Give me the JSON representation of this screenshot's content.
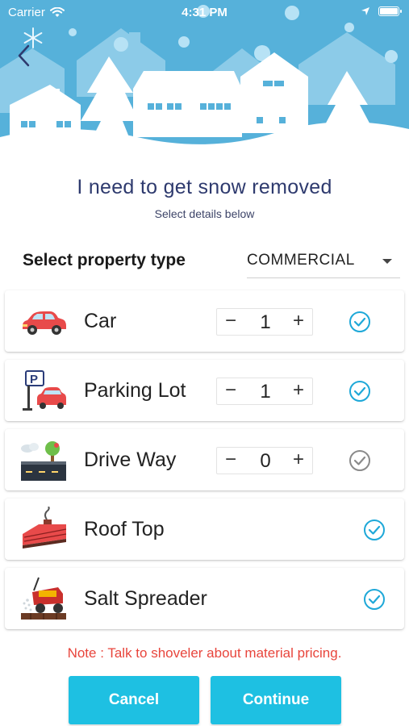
{
  "status_bar": {
    "carrier": "Carrier",
    "time": "4:31 PM"
  },
  "header": {
    "title": "I need to get snow removed",
    "subtitle": "Select details below"
  },
  "property": {
    "label": "Select property type",
    "value": "COMMERCIAL"
  },
  "services": [
    {
      "label": "Car",
      "quantity": "1",
      "selected": true,
      "icon": "car-icon"
    },
    {
      "label": "Parking Lot",
      "quantity": "1",
      "selected": true,
      "icon": "parking-lot-icon"
    },
    {
      "label": "Drive Way",
      "quantity": "0",
      "selected": false,
      "icon": "driveway-icon"
    },
    {
      "label": "Roof Top",
      "selected": true,
      "icon": "roof-top-icon"
    },
    {
      "label": "Salt Spreader",
      "selected": true,
      "icon": "salt-spreader-icon"
    }
  ],
  "stepper": {
    "minus": "−",
    "plus": "+"
  },
  "note": "Note : Talk to shoveler about material pricing.",
  "actions": {
    "cancel": "Cancel",
    "continue": "Continue"
  },
  "colors": {
    "accent": "#1ec0e2",
    "check_active": "#1ea8d8",
    "check_inactive": "#8a8a8a",
    "note": "#e8453c",
    "title": "#2e3a6e",
    "sky": "#5ab4dc"
  }
}
